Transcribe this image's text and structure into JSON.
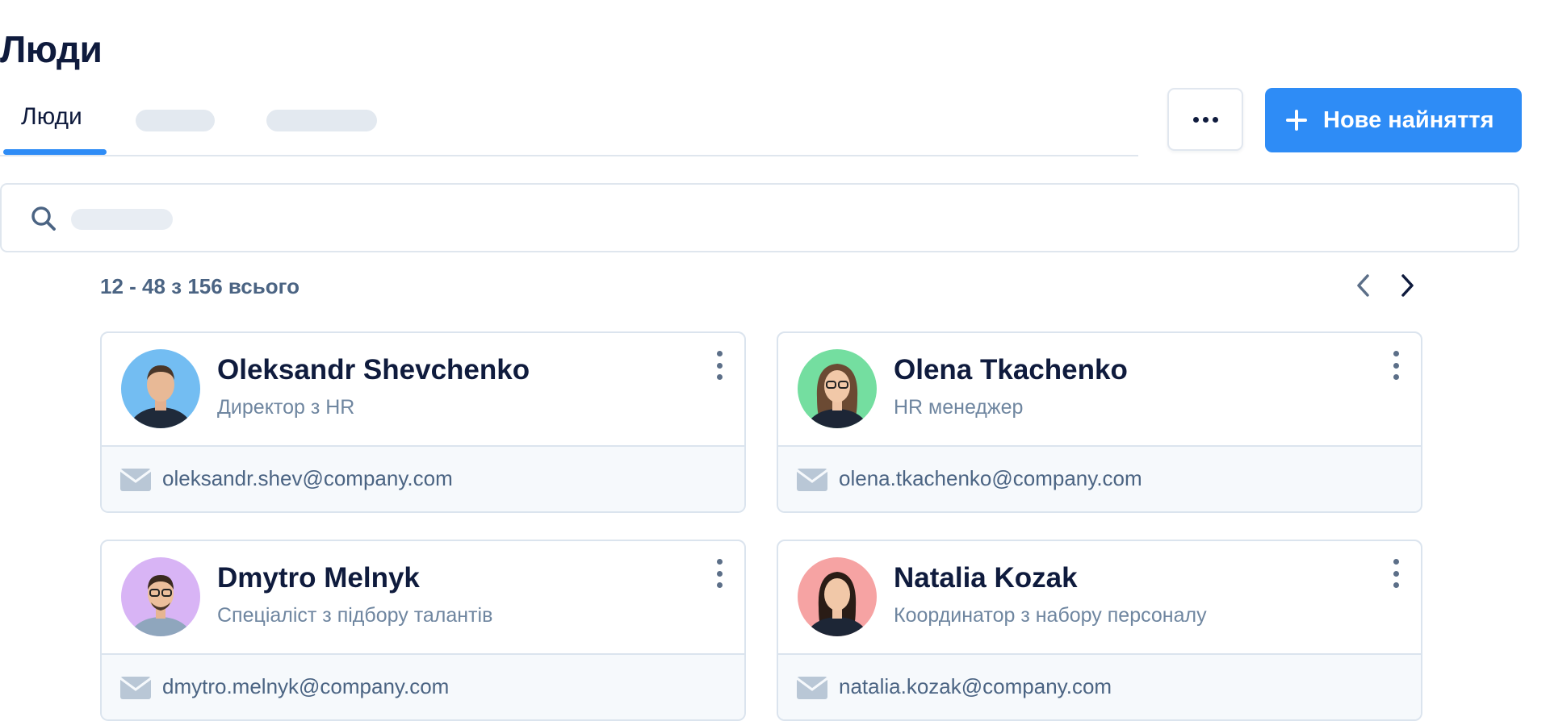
{
  "page": {
    "title": "Люди"
  },
  "tabs": {
    "active_label": "Люди"
  },
  "actions": {
    "more_label": "•••",
    "new_hire_label": "Нове найняття"
  },
  "pagination": {
    "summary": "12 - 48 з 156 всього"
  },
  "people": [
    {
      "name": "Oleksandr Shevchenko",
      "role": "Директор з HR",
      "email": "oleksandr.shev@company.com",
      "avatar_color": "#73bdf2"
    },
    {
      "name": "Olena Tkachenko",
      "role": "HR менеджер",
      "email": "olena.tkachenko@company.com",
      "avatar_color": "#74dea0"
    },
    {
      "name": "Dmytro Melnyk",
      "role": "Спеціаліст з підбору талантів",
      "email": "dmytro.melnyk@company.com",
      "avatar_color": "#d8b4f5"
    },
    {
      "name": "Natalia Kozak",
      "role": "Координатор з набору персоналу",
      "email": "natalia.kozak@company.com",
      "avatar_color": "#f6a3a3"
    }
  ],
  "colors": {
    "accent": "#2e8cf6",
    "text": "#0f1b3d",
    "muted": "#6f86a0",
    "border": "#dbe4ee"
  }
}
